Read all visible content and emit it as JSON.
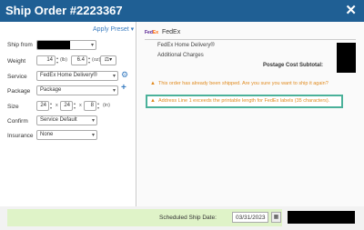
{
  "header": {
    "title": "Ship Order #2223367",
    "close": "✕"
  },
  "form": {
    "apply_preset": "Apply Preset ▾",
    "ship_from_label": "Ship from",
    "weight_label": "Weight",
    "weight_lb": "14",
    "weight_lb_unit": "(lb)",
    "weight_oz": "6.4",
    "weight_oz_unit": "(oz)",
    "service_label": "Service",
    "service_value": "FedEx Home Delivery®",
    "package_label": "Package",
    "package_value": "Package",
    "size_label": "Size",
    "size_l": "24",
    "size_w": "24",
    "size_h": "8",
    "size_unit": "(in)",
    "size_sep": "x",
    "confirm_label": "Confirm",
    "confirm_value": "Service Default",
    "insurance_label": "Insurance",
    "insurance_value": "None"
  },
  "summary": {
    "carrier_name": "FedEx",
    "line_service": "FedEx Home Delivery®",
    "line_charges": "Additional Charges",
    "subtotal_label": "Postage Cost Subtotal:"
  },
  "warnings": [
    "This order has already been shipped. Are you sure you want to ship it again?",
    "Address Line 1 exceeds the printable length for FedEx labels (35 characters)."
  ],
  "footer": {
    "ship_date_label": "Scheduled Ship Date:",
    "ship_date_value": "03/31/2023"
  },
  "icons": [
    "close-icon",
    "gear-icon",
    "plus-icon",
    "scale-icon",
    "calendar-icon",
    "warning-icon",
    "fedex-logo"
  ],
  "colors": {
    "header": "#1f5f94",
    "link": "#3a7dc1",
    "warning": "#e08a1e",
    "highlight_border": "#4bb19a",
    "footer_green": "#dff3c8"
  }
}
